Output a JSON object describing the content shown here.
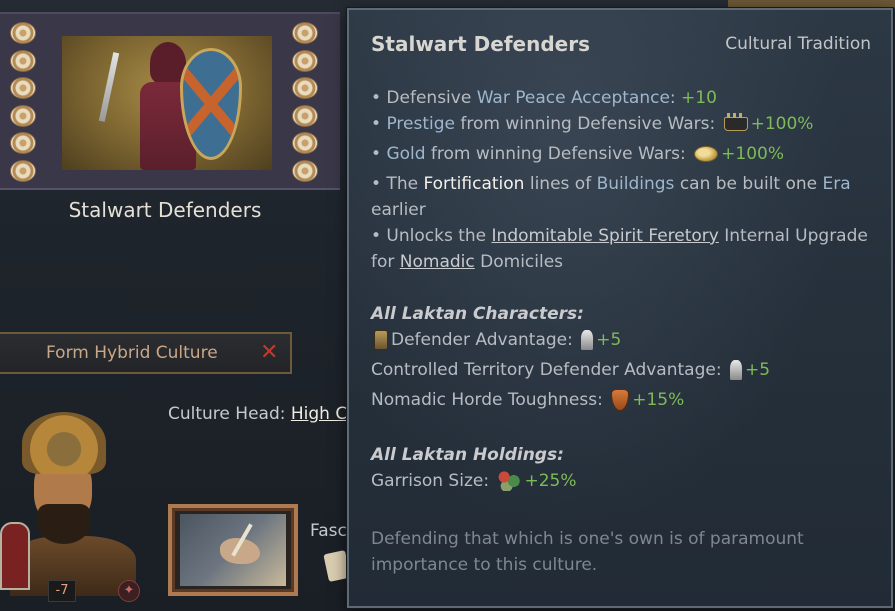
{
  "tradition": {
    "title": "Stalwart Defenders"
  },
  "actions": {
    "form_hybrid_label": "Form Hybrid Culture",
    "form_hybrid_close": "✕"
  },
  "culture_head": {
    "label": "Culture Head: ",
    "name": "High C"
  },
  "character": {
    "opinion": "-7"
  },
  "side_panel": {
    "fasc_label": "Fasc"
  },
  "tooltip": {
    "title": "Stalwart Defenders",
    "category": "Cultural Tradition",
    "effects": {
      "l1_prefix": "• Defensive ",
      "l1_highlight": "War Peace Acceptance",
      "l1_suffix": ": ",
      "l1_value": "+10",
      "l2_prefix": "• ",
      "l2_highlight": "Prestige",
      "l2_suffix": " from winning Defensive Wars: ",
      "l2_value": "+100%",
      "l3_prefix": "• ",
      "l3_highlight": "Gold",
      "l3_suffix": " from winning Defensive Wars: ",
      "l3_value": "+100%",
      "l4_prefix": "• The ",
      "l4_highlight": "Fortification",
      "l4_mid": " lines of ",
      "l4_link": "Buildings",
      "l4_suffix": " can be built one ",
      "l4_era": "Era",
      "l4_line2": "earlier",
      "l5_prefix": "• Unlocks the ",
      "l5_link1": "Indomitable Spirit Feretory",
      "l5_mid": " Internal Upgrade",
      "l5_line2_prefix": "for ",
      "l5_link2": "Nomadic",
      "l5_line2_suffix": " Domiciles"
    },
    "characters_section": {
      "heading": "All Laktan Characters:",
      "rows": [
        {
          "label": "Defender Advantage: ",
          "value": "+5"
        },
        {
          "label": "Controlled Territory Defender Advantage: ",
          "value": "+5"
        },
        {
          "label": "Nomadic Horde Toughness: ",
          "value": "+15%"
        }
      ]
    },
    "holdings_section": {
      "heading": "All Laktan Holdings:",
      "rows": [
        {
          "label": "Garrison Size: ",
          "value": "+25%"
        }
      ]
    },
    "flavor": "Defending that which is one's own is of paramount importance to this culture."
  },
  "colors": {
    "positive_value": "#7dbb57",
    "highlight_text": "#9fb6cc",
    "close_red": "#c0392b"
  }
}
